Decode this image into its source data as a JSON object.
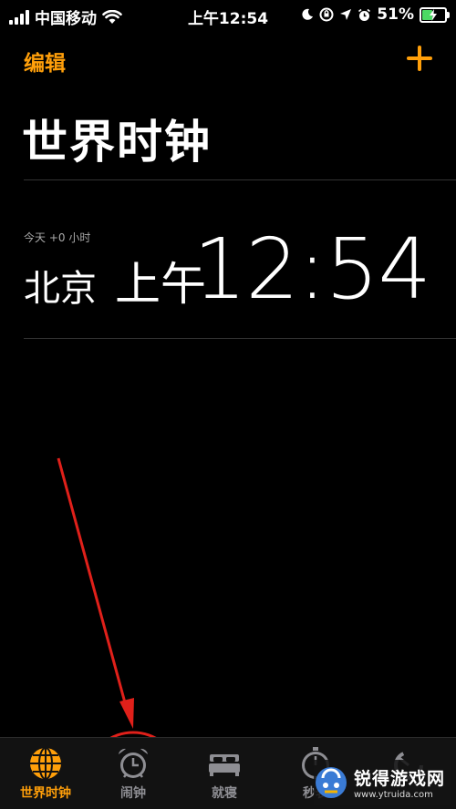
{
  "status_bar": {
    "carrier": "中国移动",
    "time": "上午12:54",
    "battery_percent": "51%",
    "battery_level": 0.51
  },
  "nav": {
    "edit_label": "编辑",
    "add_icon": "plus-icon"
  },
  "page": {
    "title": "世界时钟"
  },
  "clocks": [
    {
      "offset": "今天 +0 小时",
      "city": "北京",
      "ampm": "上午",
      "time": "12:54"
    }
  ],
  "tabs": [
    {
      "label": "世界时钟",
      "icon": "globe-icon",
      "active": true
    },
    {
      "label": "闹钟",
      "icon": "alarm-clock-icon",
      "active": false
    },
    {
      "label": "就寝",
      "icon": "bed-icon",
      "active": false
    },
    {
      "label": "秒表",
      "icon": "stopwatch-icon",
      "active": false
    },
    {
      "label": "",
      "icon": "timer-icon",
      "active": false
    }
  ],
  "watermark": {
    "name": "锐得游戏网",
    "url": "www.ytruida.com"
  },
  "colors": {
    "accent": "#ff9f0a",
    "annotation": "#e0201a",
    "inactive_tab": "#8e8e93"
  }
}
